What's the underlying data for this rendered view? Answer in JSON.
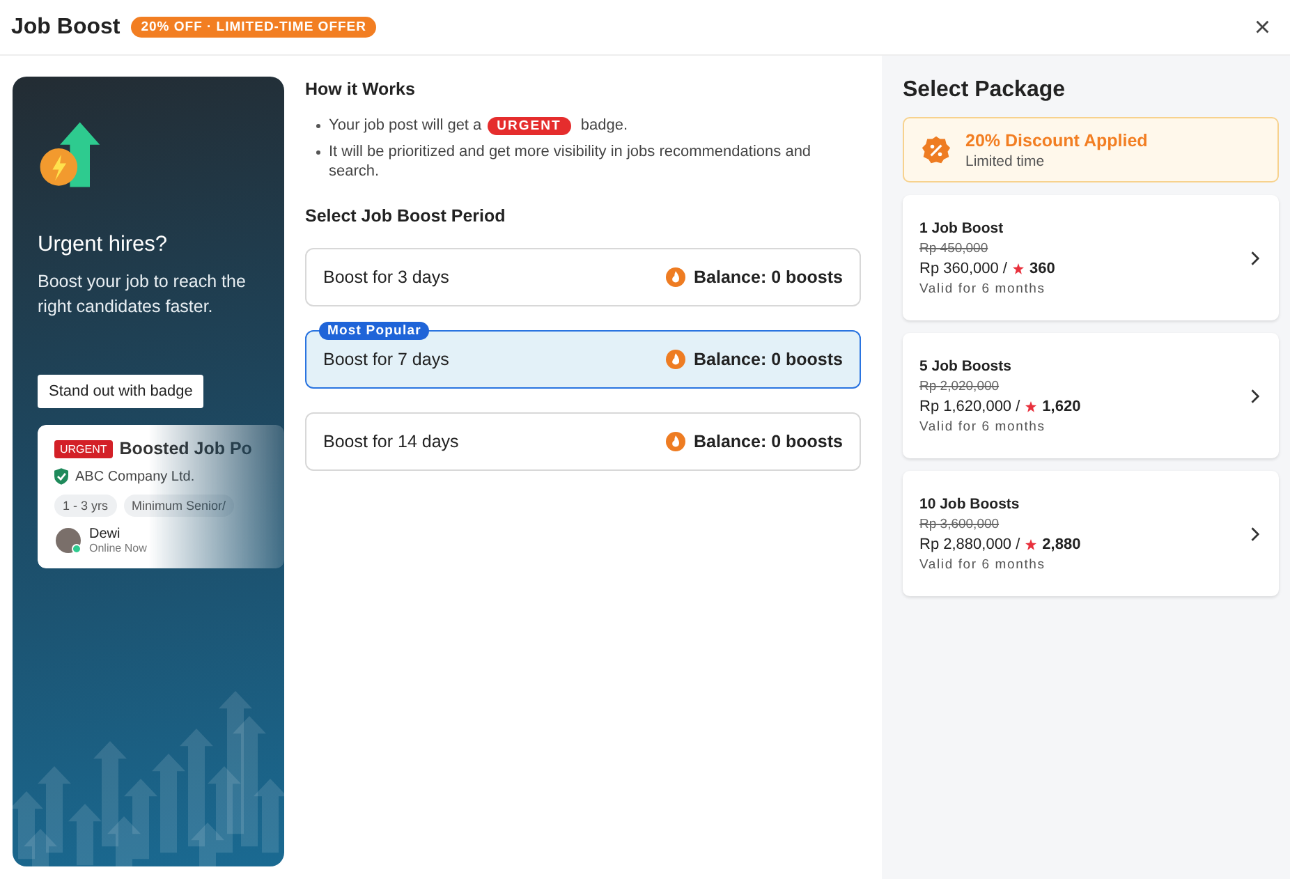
{
  "header": {
    "title": "Job Boost",
    "offer_badge": "20% OFF · LIMITED-TIME OFFER",
    "close": "×"
  },
  "promo": {
    "heading": "Urgent hires?",
    "text": "Boost your job to reach the right candidates faster.",
    "tooltip": "Stand out with badge",
    "sample": {
      "badge": "URGENT",
      "title": "Boosted Job Po",
      "company": "ABC Company Ltd.",
      "tags": [
        "1 - 3 yrs",
        "Minimum Senior/"
      ],
      "recruiter": "Dewi",
      "status": "Online Now"
    }
  },
  "how_it_works": {
    "title": "How it Works",
    "bullets": [
      {
        "text": "Your job post will get a",
        "badge": "URGENT",
        "text_after": "badge."
      },
      {
        "text": "It will be prioritized and get more visibility in jobs recommendations and search."
      }
    ]
  },
  "period": {
    "title": "Select Job Boost Period",
    "options": [
      {
        "label": "Boost for 3 days",
        "balance": "Balance: 0 boosts",
        "selected": false
      },
      {
        "label": "Boost for 7 days",
        "balance": "Balance: 0 boosts",
        "selected": true,
        "tag": "Most Popular"
      },
      {
        "label": "Boost for 14 days",
        "balance": "Balance: 0 boosts",
        "selected": false
      }
    ]
  },
  "packages": {
    "title": "Select Package",
    "discount": {
      "title": "20% Discount Applied",
      "subtitle": "Limited time"
    },
    "items": [
      {
        "name": "1 Job Boost",
        "old_price": "Rp 450,000",
        "price": "Rp 360,000 /",
        "points": "360",
        "validity": "Valid for 6 months"
      },
      {
        "name": "5 Job Boosts",
        "old_price": "Rp 2,020,000",
        "price": "Rp 1,620,000 /",
        "points": "1,620",
        "validity": "Valid for 6 months"
      },
      {
        "name": "10 Job Boosts",
        "old_price": "Rp 3,600,000",
        "price": "Rp 2,880,000 /",
        "points": "2,880",
        "validity": "Valid for 6 months"
      }
    ]
  }
}
